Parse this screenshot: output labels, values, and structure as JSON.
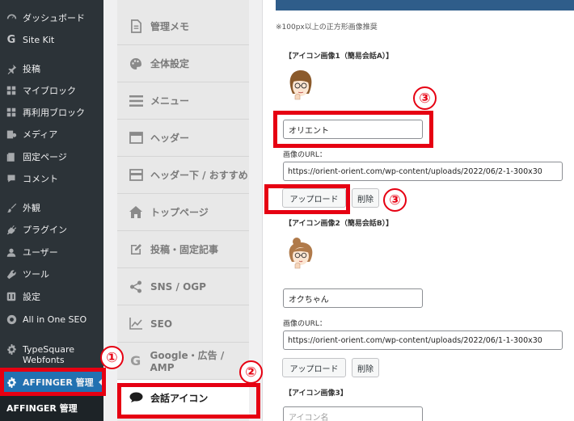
{
  "wp_sidebar": {
    "items": [
      {
        "label": "ダッシュボード",
        "icon": "dashboard-icon"
      },
      {
        "label": "Site Kit",
        "icon": "google-g-icon"
      },
      {
        "label": "投稿",
        "icon": "pin-icon"
      },
      {
        "label": "マイブロック",
        "icon": "blocks-icon"
      },
      {
        "label": "再利用ブロック",
        "icon": "blocks-icon"
      },
      {
        "label": "メディア",
        "icon": "media-icon"
      },
      {
        "label": "固定ページ",
        "icon": "page-icon"
      },
      {
        "label": "コメント",
        "icon": "comment-icon"
      },
      {
        "label": "外観",
        "icon": "brush-icon"
      },
      {
        "label": "プラグイン",
        "icon": "plugin-icon"
      },
      {
        "label": "ユーザー",
        "icon": "user-icon"
      },
      {
        "label": "ツール",
        "icon": "wrench-icon"
      },
      {
        "label": "設定",
        "icon": "settings-icon"
      },
      {
        "label": "All in One SEO",
        "icon": "seo-icon"
      },
      {
        "label": "TypeSquare",
        "icon": "gear-icon"
      },
      {
        "label": "Webfonts",
        "icon": ""
      }
    ],
    "affinger_menu": "AFFINGER 管理",
    "affinger_submenu": "AFFINGER 管理"
  },
  "settings_nav": {
    "items": [
      {
        "label": "管理メモ",
        "icon": "memo-icon"
      },
      {
        "label": "全体設定",
        "icon": "palette-icon"
      },
      {
        "label": "メニュー",
        "icon": "menu-icon"
      },
      {
        "label": "ヘッダー",
        "icon": "header-icon"
      },
      {
        "label": "ヘッダー下 / おすすめ",
        "icon": "layout-icon"
      },
      {
        "label": "トップページ",
        "icon": "home-icon"
      },
      {
        "label": "投稿・固定記事",
        "icon": "edit-icon"
      },
      {
        "label": "SNS / OGP",
        "icon": "share-icon"
      },
      {
        "label": "SEO",
        "icon": "chart-icon"
      },
      {
        "label": "Google・広告 / AMP",
        "icon": "google-g-icon"
      },
      {
        "label": "会話アイコン",
        "icon": "speech-bubble-icon"
      }
    ]
  },
  "main": {
    "note": "※100px以上の正方形画像推奨",
    "icon1": {
      "title": "【アイコン画像1（簡易会話A）】",
      "name_value": "オリエント",
      "url_label": "画像のURL：",
      "url_value": "https://orient-orient.com/wp-content/uploads/2022/06/2-1-300x30",
      "upload_label": "アップロード",
      "delete_label": "削除"
    },
    "icon2": {
      "title": "【アイコン画像2（簡易会話B）】",
      "name_value": "オクちゃん",
      "url_label": "画像のURL：",
      "url_value": "https://orient-orient.com/wp-content/uploads/2022/06/1-1-300x30",
      "upload_label": "アップロード",
      "delete_label": "削除"
    },
    "icon3": {
      "title": "【アイコン画像3】",
      "name_placeholder": "アイコン名"
    }
  },
  "callouts": [
    "①",
    "②",
    "③",
    "③"
  ],
  "colors": {
    "callout_red": "#e60012",
    "wp_sidebar": "#2c3338",
    "wp_active": "#2271b1"
  }
}
